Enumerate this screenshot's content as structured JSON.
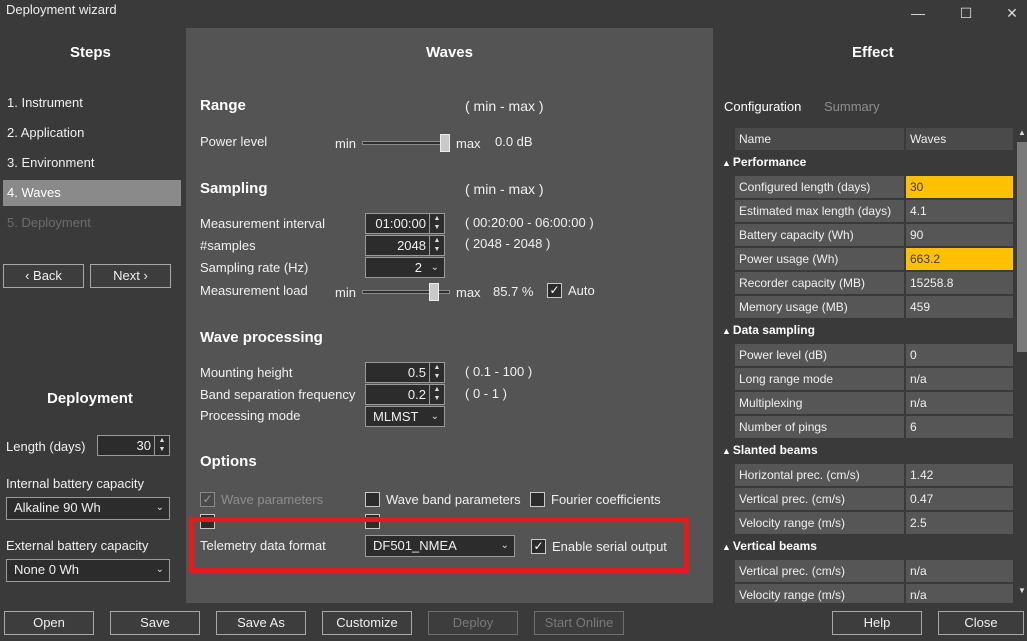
{
  "window": {
    "title": "Deployment wizard",
    "minimize": "—",
    "maximize": "☐",
    "close": "✕"
  },
  "steps": {
    "heading": "Steps",
    "items": [
      {
        "label": "1.  Instrument",
        "state": "normal"
      },
      {
        "label": "2.  Application",
        "state": "normal"
      },
      {
        "label": "3.  Environment",
        "state": "normal"
      },
      {
        "label": "4.  Waves",
        "state": "selected"
      },
      {
        "label": "5.  Deployment",
        "state": "disabled"
      }
    ],
    "back": "‹ Back",
    "next": "Next ›"
  },
  "deployment": {
    "heading": "Deployment",
    "length_label": "Length (days)",
    "length_value": "30",
    "internal_label": "Internal battery capacity",
    "internal_value": "Alkaline 90 Wh",
    "external_label": "External battery capacity",
    "external_value": "None 0 Wh"
  },
  "waves": {
    "heading": "Waves",
    "range": {
      "title": "Range",
      "hint": "( min - max )",
      "power_label": "Power level",
      "min": "min",
      "max": "max",
      "power_value": "0.0 dB",
      "power_fraction": 1.0
    },
    "sampling": {
      "title": "Sampling",
      "hint": "( min - max )",
      "interval_label": "Measurement interval",
      "interval_value": "01:00:00",
      "interval_range": "( 00:20:00 - 06:00:00 )",
      "samples_label": "#samples",
      "samples_value": "2048",
      "samples_range": "( 2048 - 2048 )",
      "rate_label": "Sampling rate (Hz)",
      "rate_value": "2",
      "load_label": "Measurement load",
      "min": "min",
      "max": "max",
      "load_value": "85.7 %",
      "load_fraction": 0.857,
      "auto_label": "Auto",
      "auto_checked": true
    },
    "processing": {
      "title": "Wave processing",
      "height_label": "Mounting height",
      "height_value": "0.5",
      "height_range": "( 0.1 - 100 )",
      "band_label": "Band separation frequency",
      "band_value": "0.2",
      "band_range": "( 0 - 1 )",
      "mode_label": "Processing mode",
      "mode_value": "MLMST"
    },
    "options": {
      "title": "Options",
      "wave_params": "Wave parameters",
      "wave_band_params": "Wave band parameters",
      "fourier": "Fourier coefficients",
      "telemetry_label": "Telemetry data format",
      "telemetry_value": "DF501_NMEA",
      "serial_label": "Enable serial output"
    }
  },
  "effect": {
    "heading": "Effect",
    "tab_config": "Configuration",
    "tab_summary": "Summary",
    "col_name": "Name",
    "col_value": "Waves",
    "groups": [
      {
        "title": "Performance",
        "rows": [
          {
            "name": "Configured length (days)",
            "value": "30",
            "highlight": true
          },
          {
            "name": "Estimated max length (days)",
            "value": "4.1",
            "highlight": false
          },
          {
            "name": "Battery capacity (Wh)",
            "value": "90",
            "highlight": false
          },
          {
            "name": "Power usage (Wh)",
            "value": "663.2",
            "highlight": true
          },
          {
            "name": "Recorder capacity (MB)",
            "value": "15258.8",
            "highlight": false
          },
          {
            "name": "Memory usage (MB)",
            "value": "459",
            "highlight": false
          }
        ]
      },
      {
        "title": "Data sampling",
        "rows": [
          {
            "name": "Power level (dB)",
            "value": "0",
            "highlight": false
          },
          {
            "name": "Long range mode",
            "value": "n/a",
            "highlight": false
          },
          {
            "name": "Multiplexing",
            "value": "n/a",
            "highlight": false
          },
          {
            "name": "Number of pings",
            "value": "6",
            "highlight": false
          }
        ]
      },
      {
        "title": "Slanted beams",
        "rows": [
          {
            "name": "Horizontal prec. (cm/s)",
            "value": "1.42",
            "highlight": false
          },
          {
            "name": "Vertical prec. (cm/s)",
            "value": "0.47",
            "highlight": false
          },
          {
            "name": "Velocity range (m/s)",
            "value": "2.5",
            "highlight": false
          }
        ]
      },
      {
        "title": "Vertical beams",
        "rows": [
          {
            "name": "Vertical prec. (cm/s)",
            "value": "n/a",
            "highlight": false
          },
          {
            "name": "Velocity range (m/s)",
            "value": "n/a",
            "highlight": false
          }
        ]
      }
    ]
  },
  "footer": {
    "open": "Open",
    "save": "Save",
    "save_as": "Save As",
    "customize": "Customize",
    "deploy": "Deploy",
    "start_online": "Start Online",
    "help": "Help",
    "close": "Close"
  },
  "colors": {
    "highlight": "#ffc000",
    "annotation": "#e8191e",
    "selected_step": "#8a8a8a"
  }
}
